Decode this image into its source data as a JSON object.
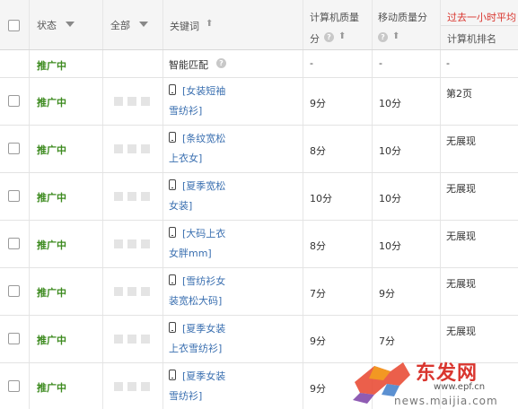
{
  "header": {
    "status": "状态",
    "all": "全部",
    "keyword": "关键词",
    "pc_quality_line1": "计算机质量",
    "pc_quality_line2": "分",
    "mobile_quality": "移动质量分",
    "past_hour": "过去一小时平均",
    "pc_rank": "计算机排名"
  },
  "rows": [
    {
      "status": "推广中",
      "keyword_line1": "智能匹配",
      "pc": "-",
      "mobile": "-",
      "rank": "-"
    },
    {
      "status": "推广中",
      "keyword_line1": "[女装短袖",
      "keyword_line2": "雪纺衫]",
      "pc": "9分",
      "mobile": "10分",
      "rank": "第2页"
    },
    {
      "status": "推广中",
      "keyword_line1": "[条纹宽松",
      "keyword_line2": "上衣女]",
      "pc": "8分",
      "mobile": "10分",
      "rank": "无展现"
    },
    {
      "status": "推广中",
      "keyword_line1": "[夏季宽松",
      "keyword_line2": "女装]",
      "pc": "10分",
      "mobile": "10分",
      "rank": "无展现"
    },
    {
      "status": "推广中",
      "keyword_line1": "[大码上衣",
      "keyword_line2": "女胖mm]",
      "pc": "8分",
      "mobile": "10分",
      "rank": "无展现"
    },
    {
      "status": "推广中",
      "keyword_line1": "[雪纺衫女",
      "keyword_line2": "装宽松大码]",
      "pc": "7分",
      "mobile": "9分",
      "rank": "无展现"
    },
    {
      "status": "推广中",
      "keyword_line1": "[夏季女装",
      "keyword_line2": "上衣雪纺衫]",
      "pc": "9分",
      "mobile": "7分",
      "rank": "无展现"
    },
    {
      "status": "推广中",
      "keyword_line1": "[夏季女装",
      "keyword_line2": "雪纺衫]",
      "pc": "9分",
      "mobile": "",
      "rank": ""
    }
  ],
  "watermark": {
    "text": "东发网",
    "url": "www.epf.cn",
    "sub": "news.maijia.com"
  },
  "colors": {
    "status_green": "#3c8a1e",
    "keyword_blue": "#3a6fb0",
    "accent_red": "#d9362f"
  }
}
